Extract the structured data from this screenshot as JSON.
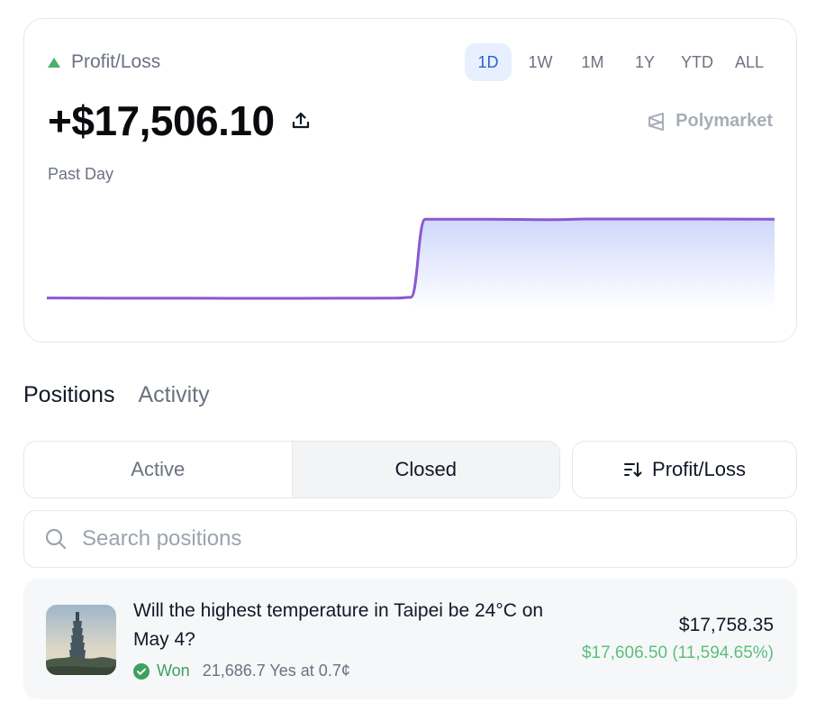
{
  "summary": {
    "label": "Profit/Loss",
    "amount": "+$17,506.10",
    "period": "Past Day",
    "brand": "Polymarket",
    "timeframes": [
      "1D",
      "1W",
      "1M",
      "1Y",
      "YTD",
      "ALL"
    ],
    "active_timeframe": "1D",
    "trend_color": "#4caf6e"
  },
  "chart_data": {
    "type": "area",
    "title": "",
    "xlabel": "",
    "ylabel": "",
    "grid": false,
    "x": [
      0,
      0.1,
      0.2,
      0.3,
      0.4,
      0.48,
      0.5,
      0.52,
      0.56,
      0.6,
      0.7,
      0.74,
      0.8,
      0.9,
      1.0
    ],
    "series": [
      {
        "values": [
          -250,
          -300,
          -300,
          -320,
          -300,
          -270,
          -100,
          17506,
          17506,
          17506,
          17400,
          17556,
          17556,
          17560,
          17506
        ]
      }
    ],
    "colors": {
      "low": "#8c57d2",
      "high": "#2f5bd6",
      "fill": "#c9d3fb"
    }
  },
  "tabs": [
    {
      "label": "Positions",
      "active": true
    },
    {
      "label": "Activity",
      "active": false
    }
  ],
  "filters": {
    "segments": [
      "Active",
      "Closed"
    ],
    "selected": "Closed",
    "sort_label": "Profit/Loss"
  },
  "search": {
    "placeholder": "Search positions",
    "value": ""
  },
  "positions": [
    {
      "title": "Will the highest temperature in Taipei be 24°C on May 4?",
      "status": "Won",
      "detail": "21,686.7 Yes at 0.7¢",
      "value": "$17,758.35",
      "pnl": "$17,606.50 (11,594.65%)"
    }
  ],
  "colors": {
    "accent": "#2f5fd6",
    "win": "#3ea05f",
    "pnl": "#5cbf7c"
  }
}
